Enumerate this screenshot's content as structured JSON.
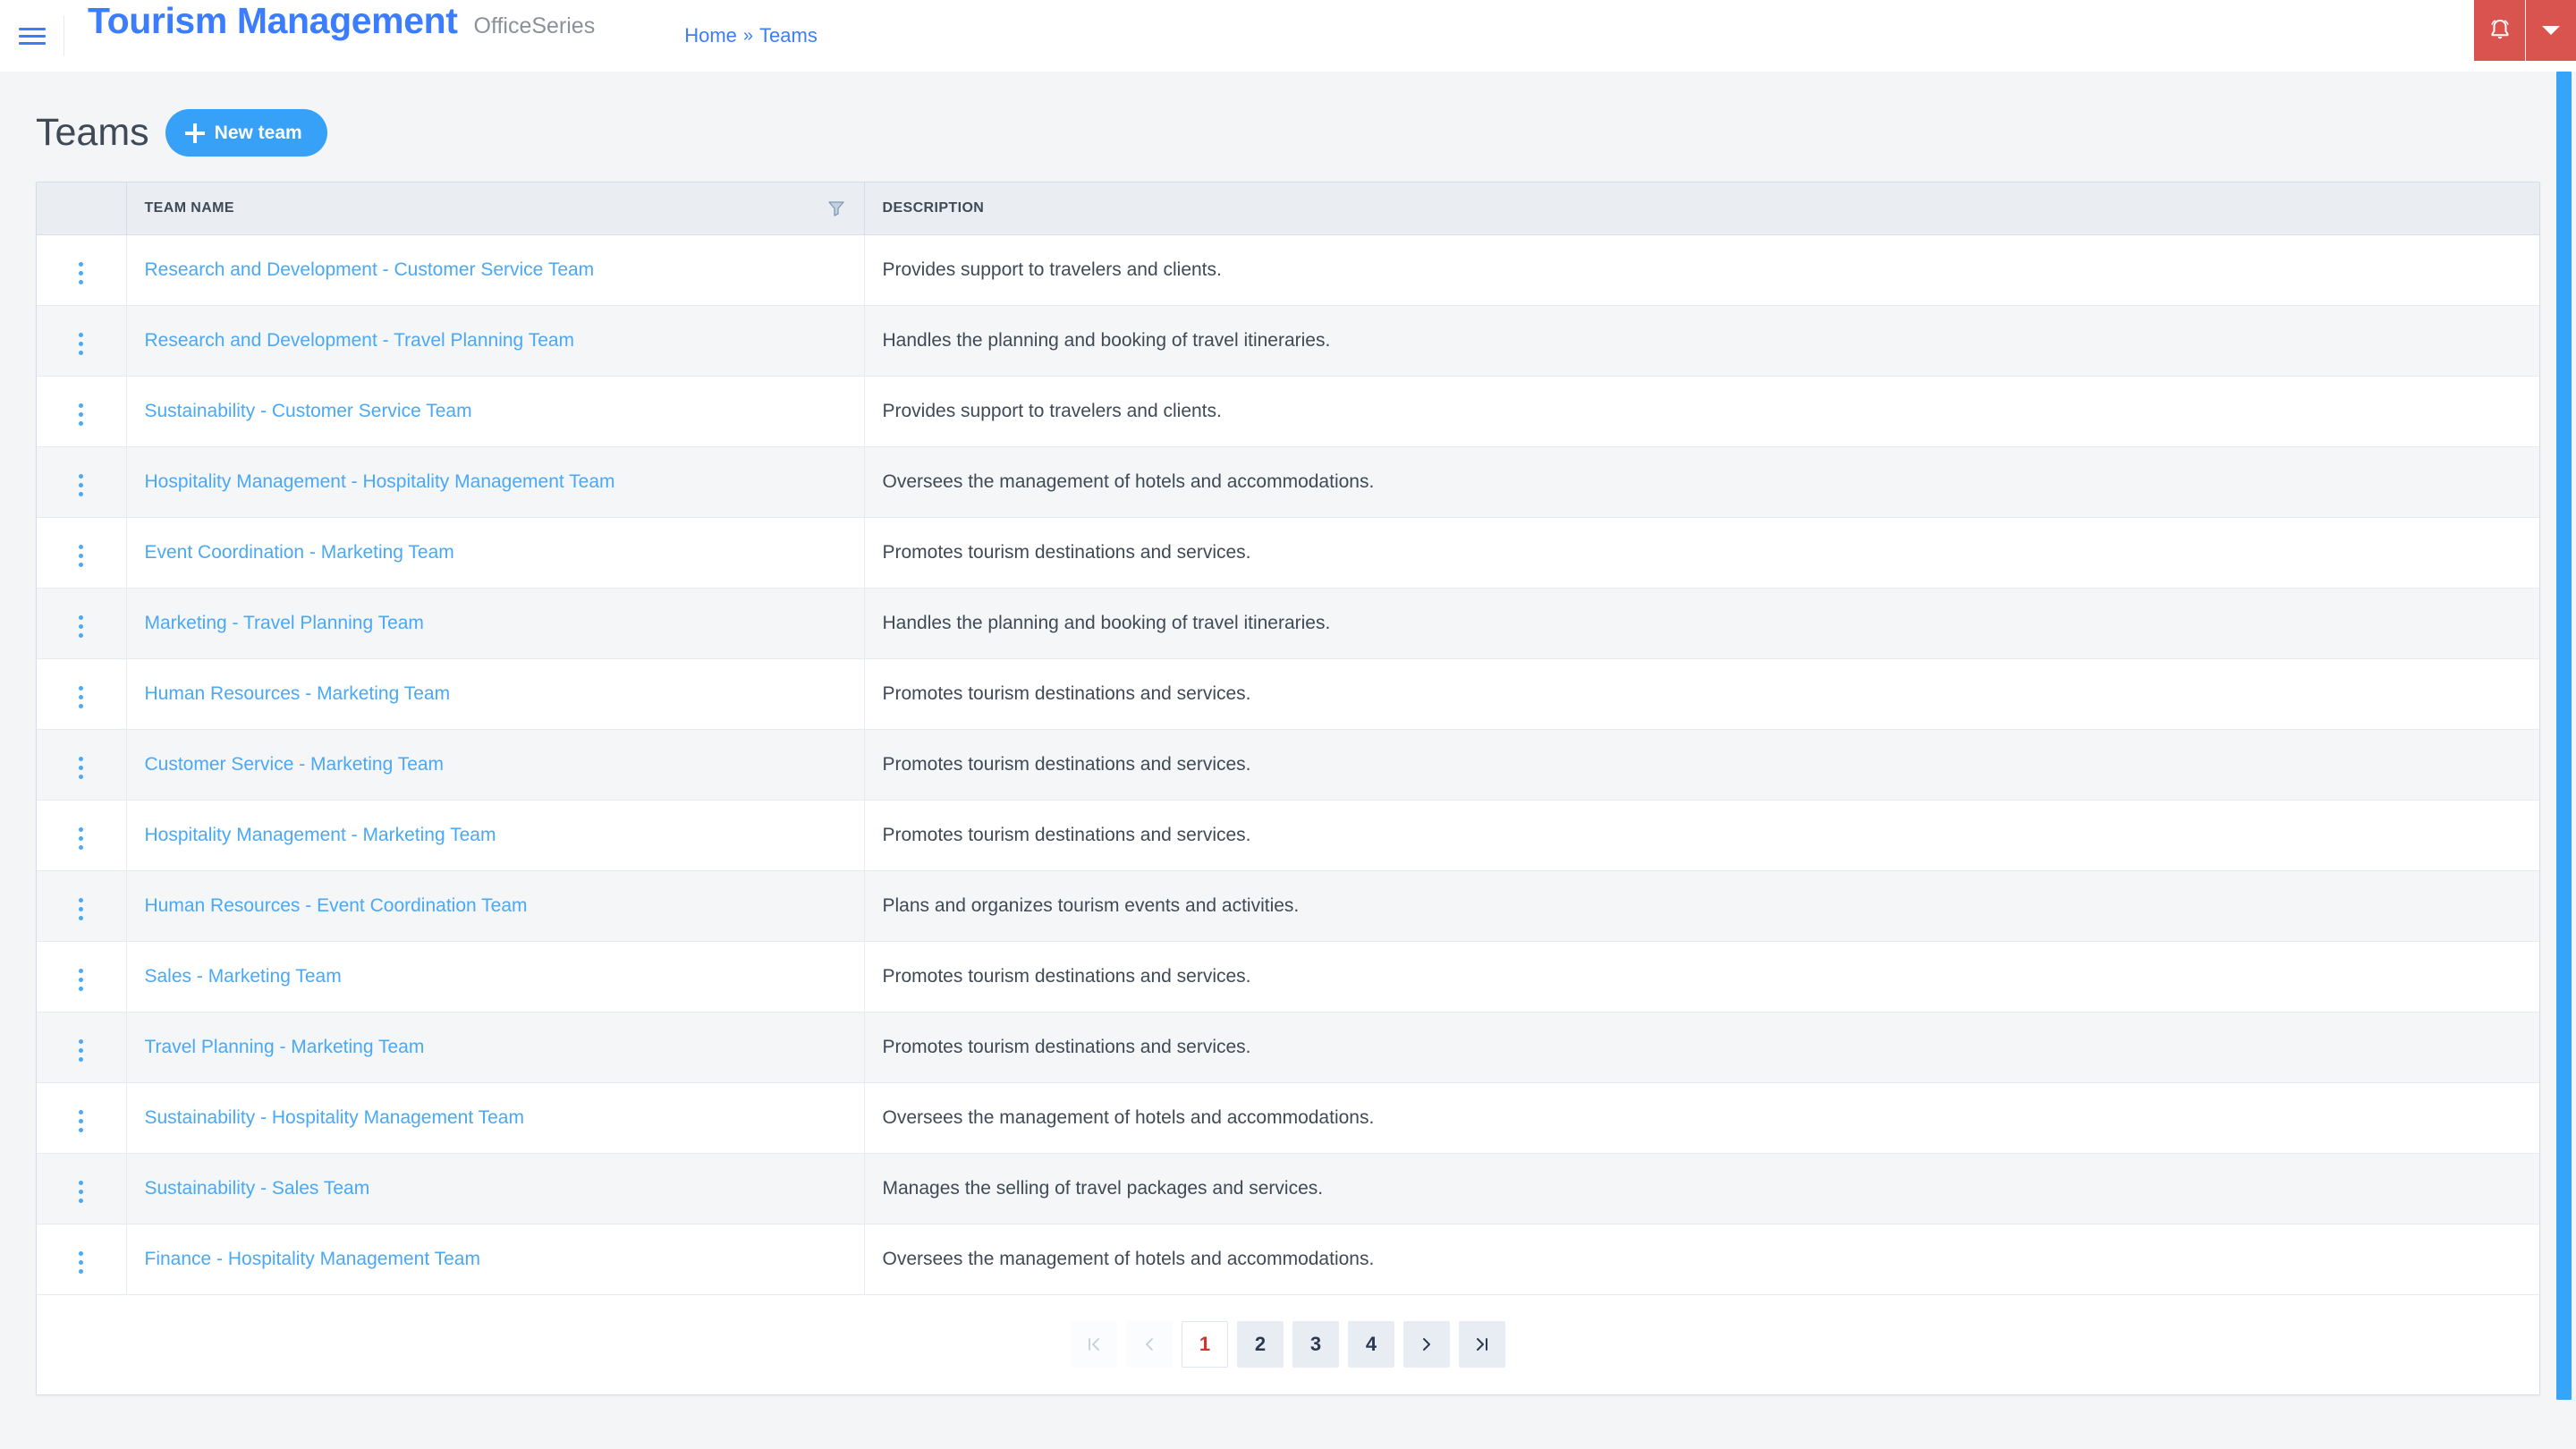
{
  "navbar": {
    "menu_icon": "hamburger-menu-icon",
    "brand_title": "Tourism Management",
    "brand_subtitle": "OfficeSeries",
    "breadcrumb": {
      "home": "Home",
      "separator": "»",
      "current": "Teams"
    },
    "notification_icon": "bell-icon",
    "dropdown_icon": "caret-down-icon",
    "accent_red": "#d9534f",
    "accent_blue": "#3b7dfd"
  },
  "page": {
    "title": "Teams",
    "new_button_label": "New team",
    "new_button_icon": "plus-icon",
    "new_button_color": "#37a1f7"
  },
  "table": {
    "columns": [
      {
        "key": "actions",
        "label": ""
      },
      {
        "key": "name",
        "label": "TEAM NAME",
        "filter_icon": "funnel-filter-icon"
      },
      {
        "key": "description",
        "label": "DESCRIPTION"
      }
    ],
    "row_action_icon": "kebab-menu-icon",
    "rows": [
      {
        "name": "Research and Development - Customer Service Team",
        "description": "Provides support to travelers and clients."
      },
      {
        "name": "Research and Development - Travel Planning Team",
        "description": "Handles the planning and booking of travel itineraries."
      },
      {
        "name": "Sustainability - Customer Service Team",
        "description": "Provides support to travelers and clients."
      },
      {
        "name": "Hospitality Management - Hospitality Management Team",
        "description": "Oversees the management of hotels and accommodations."
      },
      {
        "name": "Event Coordination - Marketing Team",
        "description": "Promotes tourism destinations and services."
      },
      {
        "name": "Marketing - Travel Planning Team",
        "description": "Handles the planning and booking of travel itineraries."
      },
      {
        "name": "Human Resources - Marketing Team",
        "description": "Promotes tourism destinations and services."
      },
      {
        "name": "Customer Service - Marketing Team",
        "description": "Promotes tourism destinations and services."
      },
      {
        "name": "Hospitality Management - Marketing Team",
        "description": "Promotes tourism destinations and services."
      },
      {
        "name": "Human Resources - Event Coordination Team",
        "description": "Plans and organizes tourism events and activities."
      },
      {
        "name": "Sales - Marketing Team",
        "description": "Promotes tourism destinations and services."
      },
      {
        "name": "Travel Planning - Marketing Team",
        "description": "Promotes tourism destinations and services."
      },
      {
        "name": "Sustainability - Hospitality Management Team",
        "description": "Oversees the management of hotels and accommodations."
      },
      {
        "name": "Sustainability - Sales Team",
        "description": "Manages the selling of travel packages and services."
      },
      {
        "name": "Finance - Hospitality Management Team",
        "description": "Oversees the management of hotels and accommodations."
      }
    ]
  },
  "pagination": {
    "first_label": "|<",
    "prev_label": "<",
    "next_label": ">",
    "last_label": ">|",
    "pages": [
      "1",
      "2",
      "3",
      "4"
    ],
    "current_page": "1",
    "active_color": "#d0342c"
  }
}
